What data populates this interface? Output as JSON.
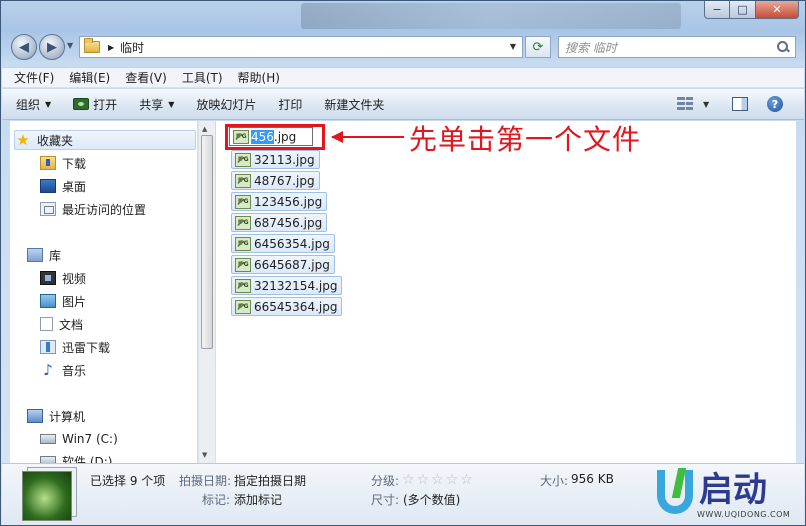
{
  "window": {
    "caption": {
      "minimize": "−",
      "maximize": "□",
      "close": "✕"
    }
  },
  "address_bar": {
    "path": "临时",
    "search_placeholder": "搜索 临时"
  },
  "menu": [
    "文件(F)",
    "编辑(E)",
    "查看(V)",
    "工具(T)",
    "帮助(H)"
  ],
  "commands": {
    "organize": "组织",
    "open": "打开",
    "share": "共享",
    "slideshow": "放映幻灯片",
    "print": "打印",
    "new_folder": "新建文件夹"
  },
  "nav": {
    "favorites": "收藏夹",
    "downloads": "下载",
    "desktop": "桌面",
    "recent": "最近访问的位置",
    "libraries": "库",
    "videos": "视频",
    "pictures": "图片",
    "documents": "文档",
    "thunder": "迅雷下载",
    "music": "音乐",
    "computer": "计算机",
    "drive_c": "Win7 (C:)",
    "drive_d": "软件 (D:)"
  },
  "files": {
    "icon_label": "JPG",
    "rename_selected": "456",
    "rename_rest": ".jpg",
    "items": [
      "32113.jpg",
      "48767.jpg",
      "123456.jpg",
      "687456.jpg",
      "6456354.jpg",
      "6645687.jpg",
      "32132154.jpg",
      "66545364.jpg"
    ]
  },
  "annotation": {
    "text": "先单击第一个文件",
    "color": "#e2161c"
  },
  "details": {
    "selected": "已选择 9 个项",
    "date_label": "拍摄日期:",
    "date_value": "指定拍摄日期",
    "tag_label": "标记:",
    "tag_value": "添加标记",
    "rating_label": "分级:",
    "rating_value": 0,
    "size_label": "大小:",
    "size_value": "956 KB",
    "dims_label": "尺寸:",
    "dims_value": "(多个数值)"
  },
  "logo": {
    "text": "启动",
    "url": "WWW.UQIDONG.COM"
  }
}
